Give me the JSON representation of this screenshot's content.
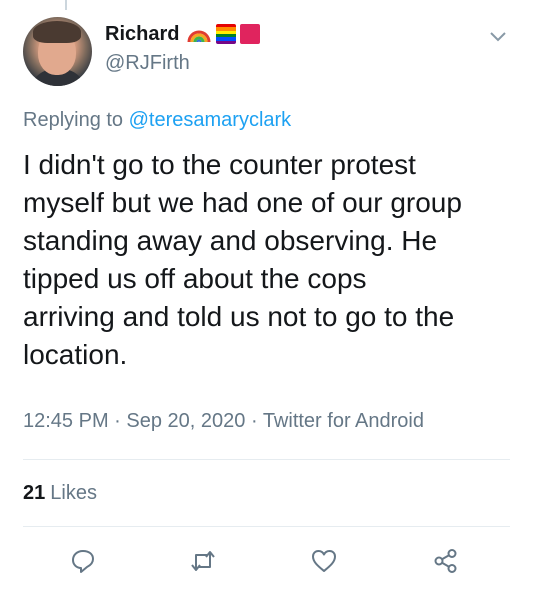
{
  "tweet": {
    "author": {
      "display_name": "Richard",
      "handle": "@RJFirth",
      "name_emojis": [
        "rainbow-icon",
        "rainbow-flag-icon",
        "red-square-icon"
      ]
    },
    "reply": {
      "prefix": "Replying to",
      "handle": "@teresamaryclark"
    },
    "text_lines": [
      "I didn't go to the counter protest",
      "myself but we had one of our group",
      "standing away and observing. He",
      "tipped us off about the cops",
      "arriving and told us not to go to the",
      "location."
    ],
    "timestamp": "12:45 PM · Sep 20, 2020",
    "separator": "·",
    "source": "Twitter for Android",
    "likes": {
      "count": "21",
      "label": "Likes"
    }
  },
  "actions": [
    {
      "name": "reply-icon"
    },
    {
      "name": "retweet-icon"
    },
    {
      "name": "like-icon"
    },
    {
      "name": "share-icon"
    }
  ],
  "colors": {
    "text_primary": "#14171a",
    "text_secondary": "#657786",
    "link": "#1da1f2",
    "divider": "#e6ecf0"
  }
}
